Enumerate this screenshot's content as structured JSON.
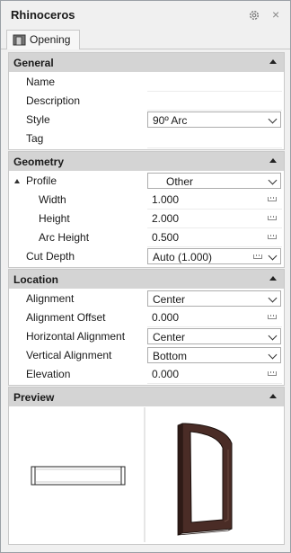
{
  "window": {
    "title": "Rhinoceros",
    "settings_icon": "gear-icon",
    "close_glyph": "×"
  },
  "tab": {
    "label": "Opening",
    "icon": "opening-icon"
  },
  "general": {
    "header": "General",
    "rows": [
      {
        "label": "Name",
        "value": ""
      },
      {
        "label": "Description",
        "value": ""
      },
      {
        "label": "Style",
        "value": "90º Arc"
      },
      {
        "label": "Tag",
        "value": ""
      }
    ]
  },
  "geometry": {
    "header": "Geometry",
    "profile": {
      "label": "Profile",
      "value": "Other"
    },
    "width": {
      "label": "Width",
      "value": "1.000"
    },
    "height": {
      "label": "Height",
      "value": "2.000"
    },
    "arc_height": {
      "label": "Arc Height",
      "value": "0.500"
    },
    "cut_depth": {
      "label": "Cut Depth",
      "value": "Auto (1.000)"
    }
  },
  "location": {
    "header": "Location",
    "alignment": {
      "label": "Alignment",
      "value": "Center"
    },
    "alignment_offset": {
      "label": "Alignment Offset",
      "value": "0.000"
    },
    "horizontal_alignment": {
      "label": "Horizontal Alignment",
      "value": "Center"
    },
    "vertical_alignment": {
      "label": "Vertical Alignment",
      "value": "Bottom"
    },
    "elevation": {
      "label": "Elevation",
      "value": "0.000"
    }
  },
  "preview": {
    "header": "Preview"
  },
  "colors": {
    "frame": "#4a2c26",
    "header_bg": "#d4d4d4"
  }
}
